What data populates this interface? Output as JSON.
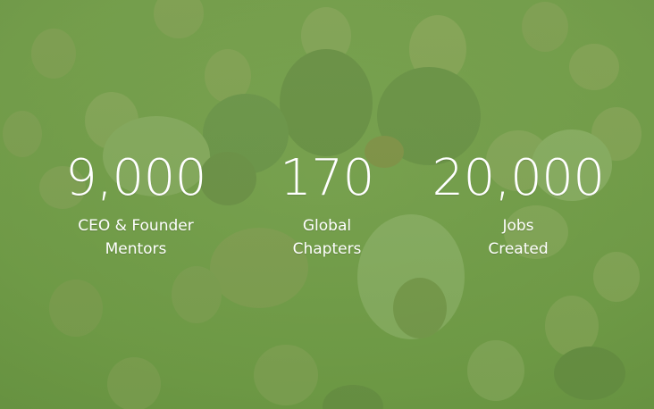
{
  "colors": {
    "overlay_top": "#7aa64f",
    "overlay_bottom": "#6f9d45",
    "text": "#ffffff"
  },
  "stats": [
    {
      "value": "9,000",
      "label_line1": "CEO & Founder",
      "label_line2": "Mentors"
    },
    {
      "value": "170",
      "label_line1": "Global",
      "label_line2": "Chapters"
    },
    {
      "value": "20,000",
      "label_line1": "Jobs",
      "label_line2": "Created"
    }
  ]
}
